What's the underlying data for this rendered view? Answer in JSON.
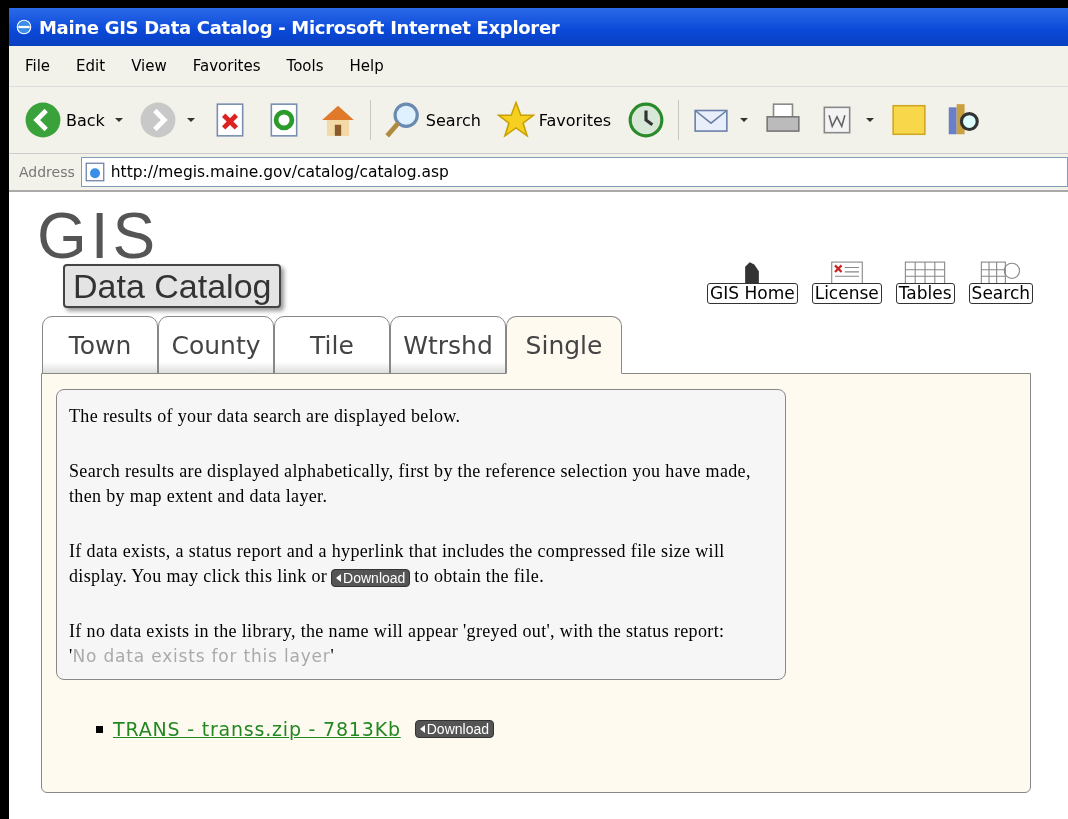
{
  "window": {
    "title": "Maine GIS Data Catalog - Microsoft Internet Explorer"
  },
  "menu": [
    "File",
    "Edit",
    "View",
    "Favorites",
    "Tools",
    "Help"
  ],
  "toolbar": [
    {
      "kind": "back",
      "label": "Back"
    },
    {
      "kind": "forward"
    },
    {
      "kind": "stop"
    },
    {
      "kind": "refresh"
    },
    {
      "kind": "home"
    },
    {
      "kind": "search",
      "label": "Search"
    },
    {
      "kind": "favorites",
      "label": "Favorites"
    },
    {
      "kind": "history"
    },
    {
      "kind": "mail"
    },
    {
      "kind": "print"
    },
    {
      "kind": "edit"
    },
    {
      "kind": "note"
    },
    {
      "kind": "research"
    }
  ],
  "address": {
    "label": "Address",
    "url": "http://megis.maine.gov/catalog/catalog.asp"
  },
  "logo": {
    "big": "GIS",
    "title": "Data Catalog"
  },
  "nav": [
    {
      "kind": "home",
      "label": "GIS Home"
    },
    {
      "kind": "license",
      "label": "License"
    },
    {
      "kind": "tables",
      "label": "Tables"
    },
    {
      "kind": "search",
      "label": "Search"
    }
  ],
  "tabs": [
    {
      "label": "Town",
      "selected": false
    },
    {
      "label": "County",
      "selected": false
    },
    {
      "label": "Tile",
      "selected": false
    },
    {
      "label": "Wtrshd",
      "selected": false
    },
    {
      "label": "Single",
      "selected": true
    }
  ],
  "info": [
    [
      {
        "kind": "text",
        "text": "The results of your data search are displayed below."
      }
    ],
    [
      {
        "kind": "text",
        "text": "Search results are displayed alphabetically, first by the reference selection you have made, then by map extent and data layer."
      }
    ],
    [
      {
        "kind": "text",
        "text": "If data exists, a status report and a hyperlink that includes the compressed file size will display. You may click this link or"
      },
      {
        "kind": "badge",
        "text": "Download"
      },
      {
        "kind": "text",
        "text": "to obtain the file."
      }
    ],
    [
      {
        "kind": "text",
        "text": "If no data exists in the library, the name will appear 'greyed out', with the status report: '"
      },
      {
        "kind": "grey",
        "text": "No data exists for this layer"
      },
      {
        "kind": "text",
        "text": "'"
      }
    ]
  ],
  "results": [
    {
      "link": "TRANS - transs.zip - 7813Kb",
      "badge": "Download"
    }
  ]
}
